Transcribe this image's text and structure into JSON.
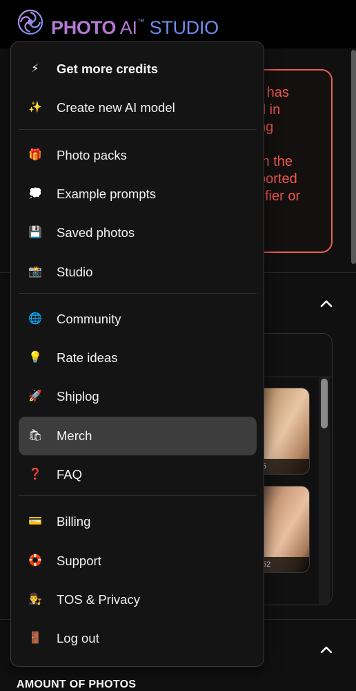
{
  "header": {
    "brand_bold": "PHOTO",
    "brand_ai": "AI",
    "brand_tm": "™",
    "brand_studio": "STUDIO"
  },
  "background": {
    "warning_lines": [
      "\" has",
      "d in",
      "ng",
      "",
      "th the",
      "ported",
      "tifier or"
    ],
    "thumb_captions": [
      "5",
      "52"
    ],
    "amount_label": "AMOUNT OF PHOTOS"
  },
  "menu": {
    "sections": [
      [
        {
          "label": "Get more credits",
          "icon": "lightning-icon",
          "glyph": "⚡",
          "bold": true
        },
        {
          "label": "Create new AI model",
          "icon": "sparkles-icon",
          "glyph": "✨"
        }
      ],
      [
        {
          "label": "Photo packs",
          "icon": "gift-icon",
          "glyph": "🎁"
        },
        {
          "label": "Example prompts",
          "icon": "thought-bubble-icon",
          "glyph": "💭"
        },
        {
          "label": "Saved photos",
          "icon": "floppy-disk-icon",
          "glyph": "💾"
        },
        {
          "label": "Studio",
          "icon": "camera-flash-icon",
          "glyph": "📸"
        }
      ],
      [
        {
          "label": "Community",
          "icon": "globe-icon",
          "glyph": "🌐"
        },
        {
          "label": "Rate ideas",
          "icon": "light-bulb-icon",
          "glyph": "💡"
        },
        {
          "label": "Shiplog",
          "icon": "rocket-icon",
          "glyph": "🚀"
        },
        {
          "label": "Merch",
          "icon": "shopping-bags-icon",
          "glyph": "🛍",
          "active": true
        },
        {
          "label": "FAQ",
          "icon": "question-mark-icon",
          "glyph": "❓"
        }
      ],
      [
        {
          "label": "Billing",
          "icon": "credit-card-icon",
          "glyph": "💳"
        },
        {
          "label": "Support",
          "icon": "lifebuoy-icon",
          "glyph": "🛟"
        },
        {
          "label": "TOS & Privacy",
          "icon": "judge-icon",
          "glyph": "👨‍⚖️"
        },
        {
          "label": "Log out",
          "icon": "door-icon",
          "glyph": "🚪"
        }
      ]
    ]
  },
  "colors": {
    "brand_purple": "#b47bd6",
    "brand_blue": "#6f8ff0",
    "warning_red": "#f05b50",
    "menu_bg": "#141414",
    "active_item_bg": "#3d3d3d"
  }
}
